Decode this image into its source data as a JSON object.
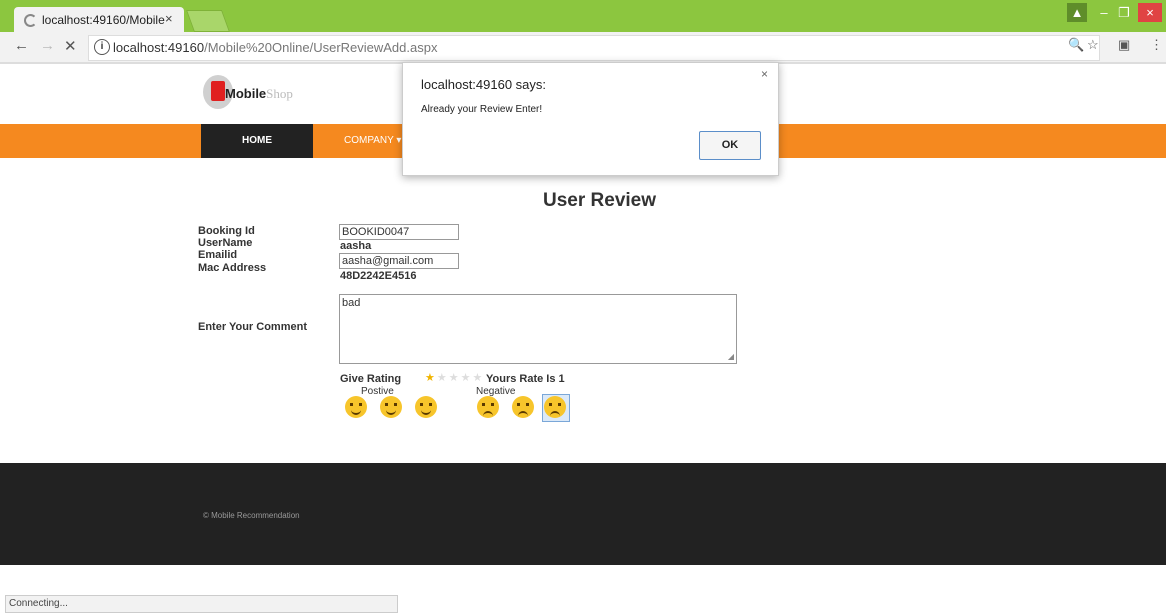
{
  "browser": {
    "tab_title": "localhost:49160/Mobile",
    "tab_close": "×",
    "url_host": "localhost:49160",
    "url_path": "/Mobile%20Online/UserReviewAdd.aspx",
    "info_icon": "i",
    "back_icon": "←",
    "forward_icon": "→",
    "stop_icon": "✕",
    "zoom_icon": "🔍",
    "bookmark_icon": "☆",
    "extension_icon": "▣",
    "menu_icon": "⋮",
    "min_icon": "–",
    "max_icon": "❐",
    "close_icon": "×",
    "user_icon": "▲"
  },
  "logo": {
    "text": "Mobile",
    "suffix": "Shop"
  },
  "nav": {
    "home": "HOME",
    "company": "COMPANY ▾"
  },
  "page": {
    "title": "User Review"
  },
  "form": {
    "booking_label": "Booking Id",
    "booking_value": "BOOKID0047",
    "username_label": "UserName",
    "username_value": "aasha",
    "email_label": "Emailid",
    "email_value": "aasha@gmail.com",
    "mac_label": "Mac Address",
    "mac_value": "48D2242E4516",
    "comment_label": "Enter Your Comment",
    "comment_value": "bad",
    "rating_label": "Give Rating",
    "stars": "★★★★★",
    "rating_value": 1,
    "rate_text": "Yours Rate Is 1",
    "positive_label": "Postive",
    "negative_label": "Negative"
  },
  "footer": {
    "text": "© Mobile Recommendation"
  },
  "status": {
    "text": "Connecting..."
  },
  "dialog": {
    "title": "localhost:49160 says:",
    "message": "Already your Review Enter!",
    "ok_label": "OK",
    "close_icon": "×"
  }
}
